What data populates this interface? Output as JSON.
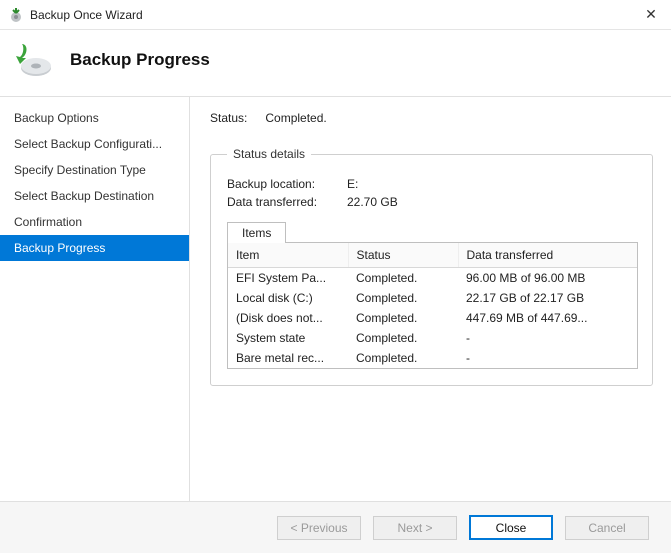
{
  "window": {
    "title": "Backup Once Wizard"
  },
  "header": {
    "title": "Backup Progress"
  },
  "nav": {
    "items": [
      "Backup Options",
      "Select Backup Configurati...",
      "Specify Destination Type",
      "Select Backup Destination",
      "Confirmation",
      "Backup Progress"
    ],
    "selected_index": 5
  },
  "status": {
    "label": "Status:",
    "value": "Completed."
  },
  "details": {
    "legend": "Status details",
    "location_label": "Backup location:",
    "location_value": "E:",
    "transferred_label": "Data transferred:",
    "transferred_value": "22.70 GB",
    "tab": "Items",
    "columns": [
      "Item",
      "Status",
      "Data transferred"
    ],
    "rows": [
      {
        "item": "EFI System Pa...",
        "status": "Completed.",
        "xfer": "96.00 MB of 96.00 MB"
      },
      {
        "item": "Local disk (C:)",
        "status": "Completed.",
        "xfer": "22.17 GB of 22.17 GB"
      },
      {
        "item": "(Disk does not...",
        "status": "Completed.",
        "xfer": "447.69 MB of 447.69..."
      },
      {
        "item": "System state",
        "status": "Completed.",
        "xfer": "-"
      },
      {
        "item": "Bare metal rec...",
        "status": "Completed.",
        "xfer": "-"
      }
    ]
  },
  "footer": {
    "previous": "< Previous",
    "next": "Next >",
    "close": "Close",
    "cancel": "Cancel"
  }
}
